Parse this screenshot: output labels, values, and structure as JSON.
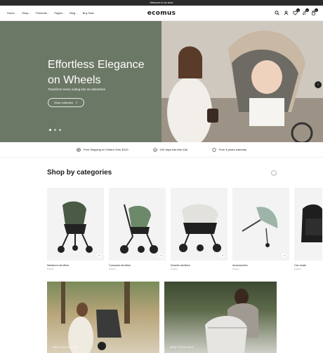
{
  "announcement": "Welcome to our store",
  "nav": {
    "items": [
      {
        "label": "Home",
        "dropdown": true
      },
      {
        "label": "Shop",
        "dropdown": true
      },
      {
        "label": "Products",
        "dropdown": true
      },
      {
        "label": "Pages",
        "dropdown": true
      },
      {
        "label": "Blog",
        "dropdown": true
      },
      {
        "label": "Buy Now",
        "dropdown": false
      }
    ],
    "logo": "ecomus",
    "badges": {
      "wishlist": "0",
      "compare": "0",
      "cart": "0"
    }
  },
  "hero": {
    "title_line1": "Effortless Elegance",
    "title_line2": "on Wheels",
    "subtitle": "Transform every outing into an adventure",
    "button": "Shop collection",
    "button_icon": "↗",
    "next_icon": "›"
  },
  "features": [
    {
      "icon": "box-icon",
      "text": "Free Shipping on Orders Over $120"
    },
    {
      "icon": "check-badge-icon",
      "text": "100 days risk-free trial"
    },
    {
      "icon": "shield-icon",
      "text": "Free 4-years warranty"
    }
  ],
  "categories": {
    "title": "Shop by categories",
    "next_icon": "→",
    "items": [
      {
        "name": "Newborn strollers",
        "count": "6 items"
      },
      {
        "name": "Compact strollers",
        "count": "6 items"
      },
      {
        "name": "Double strollers",
        "count": "6 items"
      },
      {
        "name": "Accessories",
        "count": "6 items"
      },
      {
        "name": "Car seats",
        "count": "6 items"
      }
    ]
  },
  "banners": [
    {
      "label": "NEW COLLECTION"
    },
    {
      "label": "NEW STROLLERS"
    }
  ],
  "colors": {
    "hero_bg": "#6c7866",
    "announce_bg": "#2b2b2b"
  }
}
